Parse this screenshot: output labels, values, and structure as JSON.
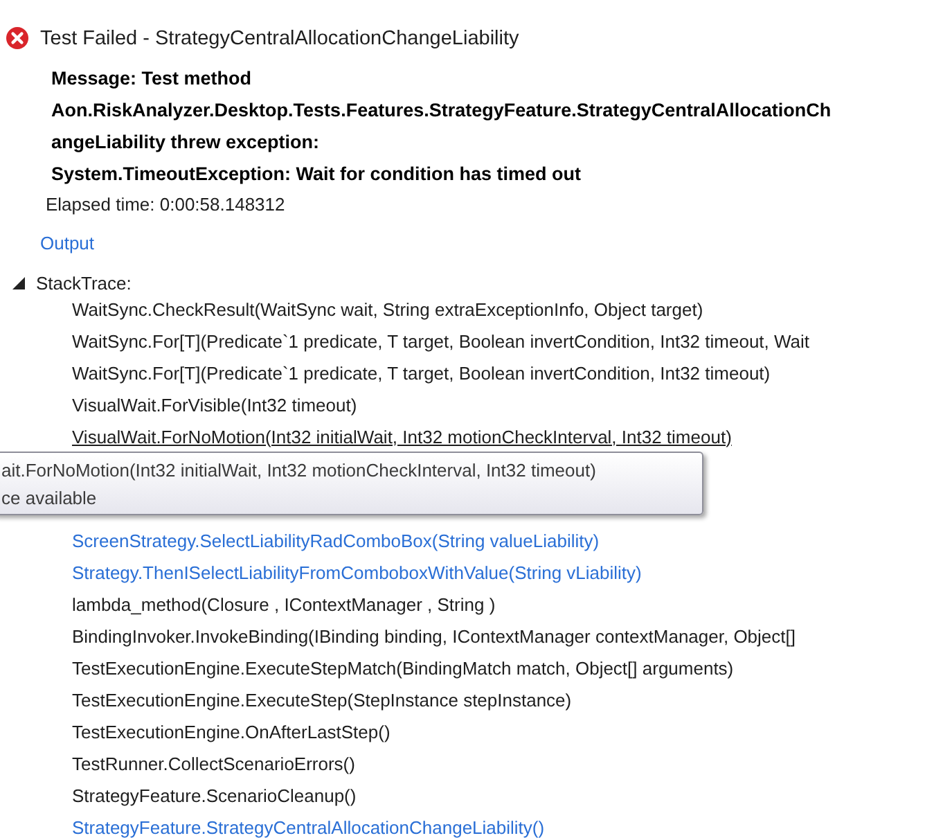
{
  "header": {
    "failed": true,
    "title": "Test Failed - StrategyCentralAllocationChangeLiability"
  },
  "message": "Message: Test method Aon.RiskAnalyzer.Desktop.Tests.Features.StrategyFeature.StrategyCentralAllocationChangeLiability threw exception: \nSystem.TimeoutException: Wait for condition has timed out",
  "elapsed": "Elapsed time: 0:00:58.148312",
  "output_link": "Output",
  "stack_trace": {
    "label": "StackTrace:",
    "expanded": true,
    "frames": [
      {
        "text": "WaitSync.CheckResult(WaitSync wait, String extraExceptionInfo, Object target)",
        "kind": "plain",
        "hovered": false
      },
      {
        "text": "WaitSync.For[T](Predicate`1 predicate, T target, Boolean invertCondition, Int32 timeout, Wait",
        "kind": "plain",
        "hovered": false
      },
      {
        "text": "WaitSync.For[T](Predicate`1 predicate, T target, Boolean invertCondition, Int32 timeout)",
        "kind": "plain",
        "hovered": false
      },
      {
        "text": "VisualWait.ForVisible(Int32 timeout)",
        "kind": "plain",
        "hovered": false
      },
      {
        "text": "VisualWait.ForNoMotion(Int32 initialWait, Int32 motionCheckInterval, Int32 timeout)",
        "kind": "plain",
        "hovered": true
      },
      {
        "kind": "hidden"
      },
      {
        "kind": "hidden"
      },
      {
        "text": "ScreenStrategy.SelectLiabilityRadComboBox(String valueLiability)",
        "kind": "link",
        "hovered": false
      },
      {
        "text": "Strategy.ThenISelectLiabilityFromComboboxWithValue(String vLiability)",
        "kind": "link",
        "hovered": false
      },
      {
        "text": "lambda_method(Closure , IContextManager , String )",
        "kind": "plain",
        "hovered": false
      },
      {
        "text": "BindingInvoker.InvokeBinding(IBinding binding, IContextManager contextManager, Object[]",
        "kind": "plain",
        "hovered": false
      },
      {
        "text": "TestExecutionEngine.ExecuteStepMatch(BindingMatch match, Object[] arguments)",
        "kind": "plain",
        "hovered": false
      },
      {
        "text": "TestExecutionEngine.ExecuteStep(StepInstance stepInstance)",
        "kind": "plain",
        "hovered": false
      },
      {
        "text": "TestExecutionEngine.OnAfterLastStep()",
        "kind": "plain",
        "hovered": false
      },
      {
        "text": "TestRunner.CollectScenarioErrors()",
        "kind": "plain",
        "hovered": false
      },
      {
        "text": "StrategyFeature.ScenarioCleanup()",
        "kind": "plain",
        "hovered": false
      },
      {
        "text": "StrategyFeature.StrategyCentralAllocationChangeLiability()",
        "kind": "link",
        "hovered": false
      }
    ]
  },
  "tooltip": {
    "lines": [
      "ait.ForNoMotion(Int32 initialWait, Int32 motionCheckInterval, Int32 timeout)",
      "ce available"
    ]
  }
}
